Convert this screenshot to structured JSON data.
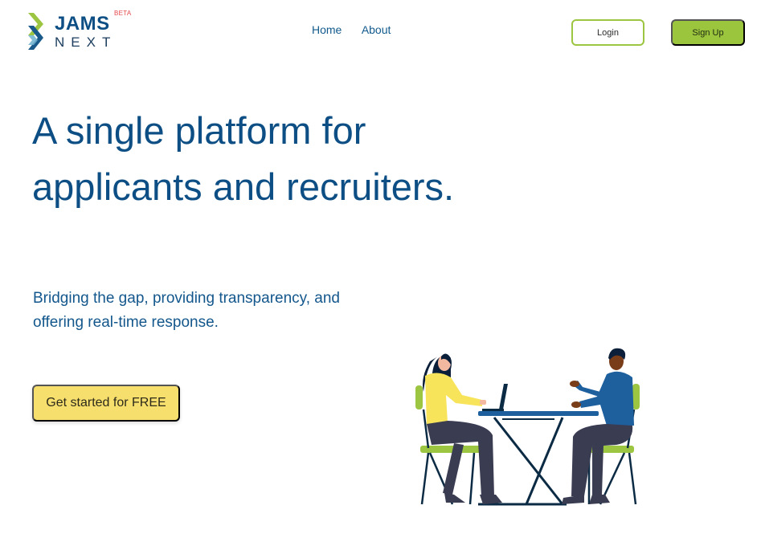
{
  "logo": {
    "word1": "JAMS",
    "word2": "NEXT",
    "badge": "BETA"
  },
  "nav": {
    "items": [
      {
        "label": "Home"
      },
      {
        "label": "About"
      }
    ]
  },
  "header": {
    "login_label": "Login",
    "signup_label": "Sign Up"
  },
  "hero": {
    "headline": "A single platform for applicants and recruiters.",
    "subtext": "Bridging the gap, providing transparency, and offering real-time response.",
    "cta_label": "Get started for FREE"
  },
  "colors": {
    "brand_blue": "#0d4f84",
    "accent_green": "#9cc53e",
    "cta_yellow": "#f7df6e",
    "beta_red": "#e3484c"
  },
  "illustration": {
    "icon": "meeting-illustration"
  }
}
